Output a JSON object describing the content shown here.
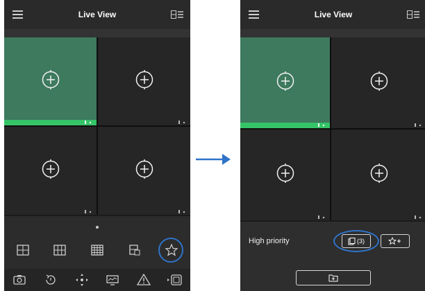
{
  "before": {
    "header": {
      "title": "Live View",
      "menu_icon": "menu-icon",
      "layout_icon": "window-layout-icon"
    },
    "tiles": [
      {
        "selected": true
      },
      {
        "selected": false
      },
      {
        "selected": false
      },
      {
        "selected": false
      }
    ],
    "layout_icons": [
      "one-window-icon",
      "four-window-icon",
      "nine-window-icon",
      "custom-layout-icon",
      "favorite-star-icon"
    ],
    "action_icons": [
      "capture-icon",
      "playback-icon",
      "ptz-icon",
      "stream-icon",
      "alarm-icon",
      "fullscreen-icon"
    ],
    "highlight_color": "#2f73c9"
  },
  "after": {
    "header": {
      "title": "Live View",
      "menu_icon": "menu-icon",
      "layout_icon": "window-layout-icon"
    },
    "tiles": [
      {
        "selected": true
      },
      {
        "selected": false
      },
      {
        "selected": false
      },
      {
        "selected": false
      }
    ],
    "favorites_panel": {
      "label": "High priority",
      "favorite_count": "(3)",
      "add_favorite_icon": "add-favorite-icon",
      "folder_icon": "add-folder-icon"
    }
  },
  "colors": {
    "selected_tile": "#3e7a5e",
    "selected_bar": "#35c468",
    "arrow": "#2f73c9"
  }
}
